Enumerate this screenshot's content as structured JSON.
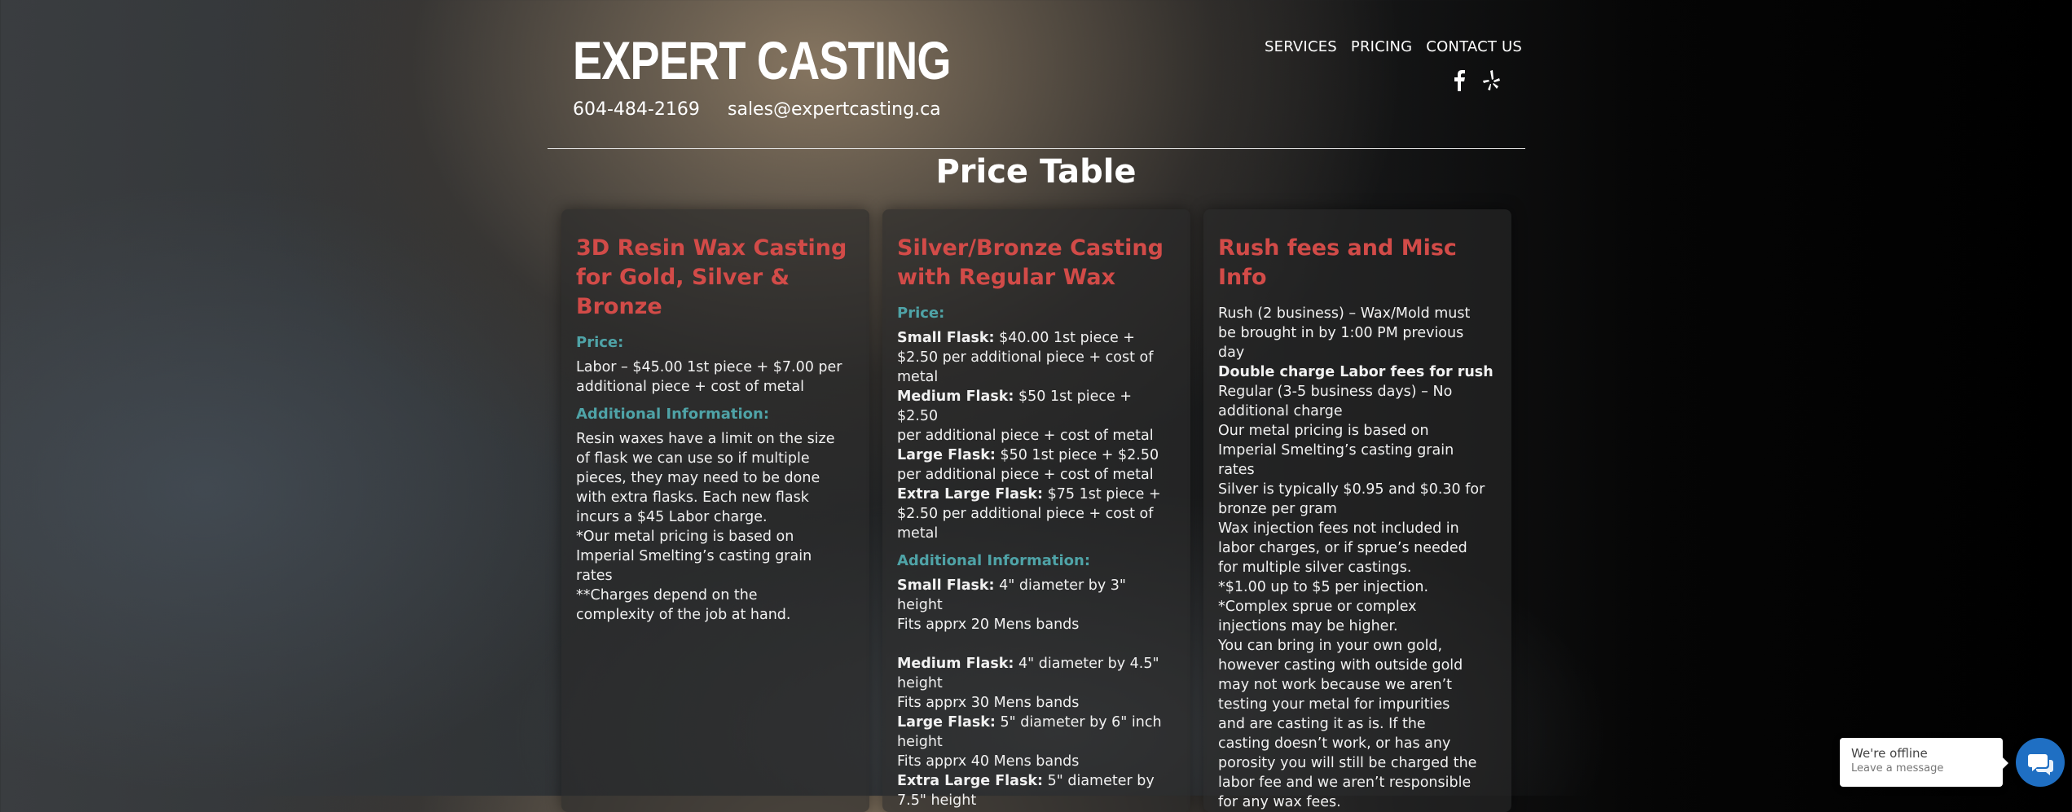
{
  "header": {
    "logo": "EXPERT CASTING",
    "phone": "604-484-2169",
    "email": "sales@expertcasting.ca",
    "nav": [
      "SERVICES",
      "PRICING",
      "CONTACT US"
    ],
    "social_icons": [
      "facebook-icon",
      "yelp-icon"
    ]
  },
  "page_title": "Price Table",
  "cards": [
    {
      "title_lines": [
        "3D Resin Wax Casting",
        "for Gold, Silver & Bronze"
      ],
      "price_heading": "Price:",
      "price_lines": [
        "Labor – $45.00 1st piece + $7.00 per",
        "additional piece + cost of metal"
      ],
      "info_heading": "Additional Information:",
      "info_lines": [
        "Resin waxes have a limit on the size",
        "of flask we can use so if multiple",
        "pieces, they may need to be done",
        "with extra flasks. Each new flask",
        "incurs a $45 Labor charge.",
        "*Our metal pricing is based on",
        "Imperial Smelting’s casting grain",
        "rates",
        "**Charges depend on the",
        "complexity of the job at hand."
      ]
    },
    {
      "title_lines": [
        "Silver/Bronze Casting",
        "with Regular Wax"
      ],
      "price_heading": "Price:",
      "price_items": [
        {
          "label": "Small Flask:",
          "lines": [
            " $40.00 1st piece +",
            "$2.50 per additional piece + cost of",
            "metal"
          ]
        },
        {
          "label": "Medium Flask:",
          "lines": [
            " $50 1st piece + $2.50",
            "per additional piece + cost of metal"
          ]
        },
        {
          "label": "Large Flask:",
          "lines": [
            " $50 1st piece + $2.50",
            "per additional piece + cost of metal"
          ]
        },
        {
          "label": "Extra Large Flask:",
          "lines": [
            " $75 1st piece +",
            "$2.50 per additional piece + cost of",
            "metal"
          ]
        }
      ],
      "info_heading": "Additional Information:",
      "flask_sizes": [
        {
          "label": "Small Flask:",
          "lines": [
            " 4\" diameter by 3\"",
            "height",
            "Fits apprx 20 Mens bands"
          ]
        },
        {
          "label": "Medium Flask:",
          "lines": [
            " 4\" diameter by 4.5\"",
            "height",
            "Fits apprx 30 Mens bands"
          ]
        },
        {
          "label": "Large Flask:",
          "lines": [
            " 5\" diameter by 6\" inch",
            "height",
            "Fits apprx 40 Mens bands"
          ]
        },
        {
          "label": "Extra Large Flask:",
          "lines": [
            " 5\" diameter by",
            "7.5\" height"
          ]
        }
      ]
    },
    {
      "title": "Rush fees and Misc Info",
      "lines_a": [
        "Rush (2 business) – Wax/Mold must",
        "be brought in by 1:00 PM previous",
        "day"
      ],
      "bold_line": "Double charge Labor fees for rush",
      "lines_b": [
        "Regular (3-5 business days) – No",
        "additional charge",
        "Our metal pricing is based on",
        "Imperial Smelting’s casting grain",
        "rates",
        "Silver is typically $0.95 and $0.30 for",
        "bronze per gram",
        "Wax injection fees not included in",
        "labor charges, or if sprue’s needed",
        "for multiple silver castings.",
        "*$1.00 up to $5 per injection.",
        "*Complex sprue or complex",
        "injections may be higher.",
        "You can bring in your own gold,",
        "however casting with outside gold",
        "may not work because we aren’t",
        "testing your metal for impurities",
        "and are casting it as is. If the",
        "casting doesn’t work, or has any",
        "porosity you will still be charged the",
        "labor fee and we aren’t responsible",
        "for any wax fees."
      ]
    }
  ],
  "chat": {
    "status": "We're offline",
    "action": "Leave a message"
  },
  "colors": {
    "card_title": "#d24b48",
    "card_subheading": "#4fa3a7",
    "chat_button": "#1f6fc3"
  }
}
